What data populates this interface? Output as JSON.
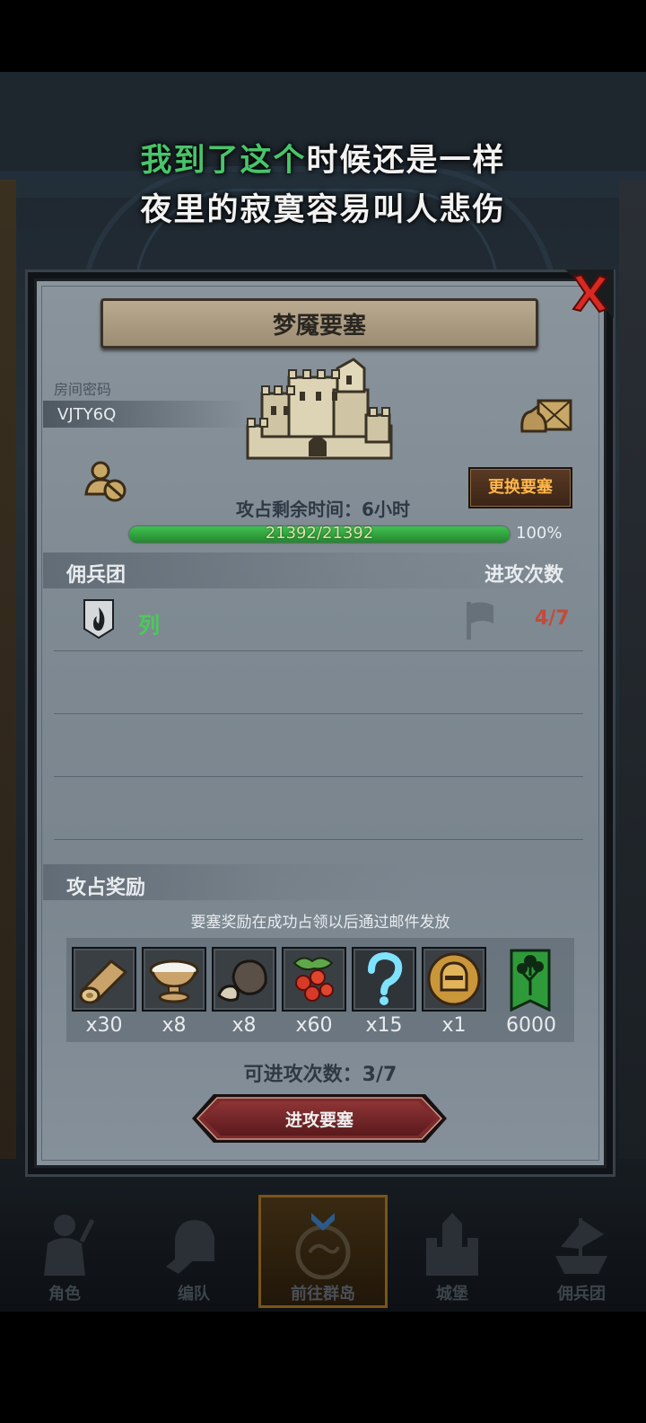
{
  "lyrics": {
    "line1_highlight": "我到了这个",
    "line1_rest": "时候还是一样",
    "line2": "夜里的寂寞容易叫人悲伤"
  },
  "panel": {
    "title": "梦魇要塞",
    "room_label": "房间密码",
    "room_code": "VJTY6Q",
    "change_button": "更换要塞",
    "time_remaining": "攻占剩余时间：6小时",
    "hp": {
      "text": "21392/21392",
      "current": 21392,
      "max": 21392
    },
    "hp_percent": "100%"
  },
  "mercenary": {
    "title": "佣兵团",
    "attack_title": "进攻次数",
    "rows": [
      {
        "name": "列",
        "attacks": "4/7",
        "emblem_icon": "fire-emblem-icon"
      }
    ]
  },
  "rewards": {
    "title": "攻占奖励",
    "note": "要塞奖励在成功占领以后通过邮件发放",
    "items": [
      {
        "icon": "wood-log-icon",
        "qty": "x30"
      },
      {
        "icon": "milk-bowl-icon",
        "qty": "x8"
      },
      {
        "icon": "ore-rock-icon",
        "qty": "x8"
      },
      {
        "icon": "berries-icon",
        "qty": "x60"
      },
      {
        "icon": "question-mark-icon",
        "qty": "x15"
      },
      {
        "icon": "knight-helmet-coin-icon",
        "qty": "x1"
      },
      {
        "icon": "tree-banner-icon",
        "qty": "6000"
      }
    ]
  },
  "remaining_attacks": "可进攻次数：3/7",
  "attack_button": "进攻要塞",
  "nav": {
    "items": [
      {
        "label": "角色",
        "icon": "knight-icon",
        "active": false
      },
      {
        "label": "编队",
        "icon": "helmet-formation-icon",
        "active": false
      },
      {
        "label": "前往群岛",
        "icon": "island-compass-icon",
        "active": true
      },
      {
        "label": "城堡",
        "icon": "castle-icon",
        "active": false
      },
      {
        "label": "佣兵团",
        "icon": "ship-icon",
        "active": false
      }
    ]
  },
  "colors": {
    "lyric_highlight": "#49c46a",
    "merc_name": "#4cc95a",
    "attack_count": "#c44a3c",
    "change_button_text": "#ffb64a",
    "hp_bar": "#2fa13e"
  }
}
